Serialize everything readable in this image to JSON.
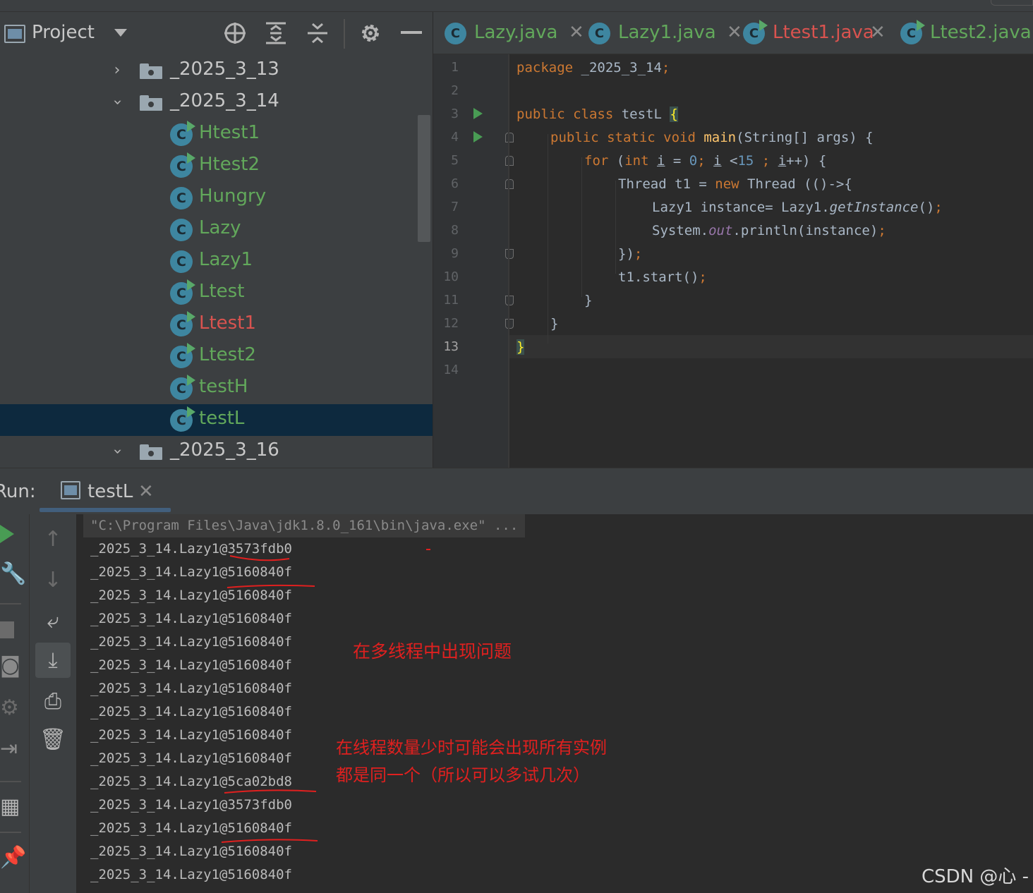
{
  "project_panel": {
    "title": "Project",
    "tree": [
      {
        "label": "_2025_3_13",
        "kind": "package",
        "expanded": false
      },
      {
        "label": "_2025_3_14",
        "kind": "package",
        "expanded": true
      },
      {
        "label": "Htest1",
        "kind": "class-runnable",
        "color": "green"
      },
      {
        "label": "Htest2",
        "kind": "class-runnable",
        "color": "green"
      },
      {
        "label": "Hungry",
        "kind": "class",
        "color": "green"
      },
      {
        "label": "Lazy",
        "kind": "class",
        "color": "green"
      },
      {
        "label": "Lazy1",
        "kind": "class",
        "color": "green"
      },
      {
        "label": "Ltest",
        "kind": "class-runnable",
        "color": "green"
      },
      {
        "label": "Ltest1",
        "kind": "class-runnable",
        "color": "red"
      },
      {
        "label": "Ltest2",
        "kind": "class-runnable",
        "color": "green"
      },
      {
        "label": "testH",
        "kind": "class-runnable",
        "color": "green"
      },
      {
        "label": "testL",
        "kind": "class-runnable",
        "color": "green",
        "selected": true
      },
      {
        "label": "_2025_3_16",
        "kind": "package",
        "expanded": true
      }
    ]
  },
  "editor": {
    "tabs": [
      {
        "label": "Lazy.java",
        "color": "green",
        "runnable": false
      },
      {
        "label": "Lazy1.java",
        "color": "green",
        "runnable": false
      },
      {
        "label": "Ltest1.java",
        "color": "red",
        "runnable": true
      },
      {
        "label": "Ltest2.java",
        "color": "green",
        "runnable": true
      }
    ],
    "line_numbers": [
      "1",
      "2",
      "3",
      "4",
      "5",
      "6",
      "7",
      "8",
      "9",
      "10",
      "11",
      "12",
      "13",
      "14"
    ],
    "current_line": "13",
    "code": {
      "l1_kw": "package",
      "l1_rest": " _2025_3_14",
      "l1_semi": ";",
      "l3_kw": "public class",
      "l3_name": " testL ",
      "l3_brace": "{",
      "l4_kw": "public static void",
      "l4_sp": " ",
      "l4_fn": "main",
      "l4_rest": "(String[] args) {",
      "l5_for": "for",
      "l5_p": " (",
      "l5_int": "int",
      "l5_sp": " ",
      "l5_i1": "i",
      "l5_eq": " = ",
      "l5_zero": "0",
      "l5_semi1": "; ",
      "l5_i2": "i",
      "l5_lt": " <",
      "l5_15": "15",
      "l5_semi2": " ; ",
      "l5_i3": "i",
      "l5_end": "++) {",
      "l6_a": "Thread t1 = ",
      "l6_new": "new",
      "l6_b": " Thread (()->{",
      "l7_a": "Lazy1 instance= Lazy1.",
      "l7_get": "getInstance",
      "l7_b": "()",
      "l7_semi": ";",
      "l8_a": "System.",
      "l8_out": "out",
      "l8_b": ".println(instance)",
      "l8_semi": ";",
      "l9_a": "})",
      "l9_semi": ";",
      "l10_a": "t1.start()",
      "l10_semi": ";",
      "l11": "}",
      "l12": "}",
      "l13": "}"
    }
  },
  "run_panel": {
    "label": "Run:",
    "tab_label": "testL",
    "command": "\"C:\\Program Files\\Java\\jdk1.8.0_161\\bin\\java.exe\" ...",
    "output": [
      "_2025_3_14.Lazy1@3573fdb0",
      "_2025_3_14.Lazy1@5160840f",
      "_2025_3_14.Lazy1@5160840f",
      "_2025_3_14.Lazy1@5160840f",
      "_2025_3_14.Lazy1@5160840f",
      "_2025_3_14.Lazy1@5160840f",
      "_2025_3_14.Lazy1@5160840f",
      "_2025_3_14.Lazy1@5160840f",
      "_2025_3_14.Lazy1@5160840f",
      "_2025_3_14.Lazy1@5160840f",
      "_2025_3_14.Lazy1@5ca02bd8",
      "_2025_3_14.Lazy1@3573fdb0",
      "_2025_3_14.Lazy1@5160840f",
      "_2025_3_14.Lazy1@5160840f",
      "_2025_3_14.Lazy1@5160840f"
    ]
  },
  "annotations": {
    "note1": "在多线程中出现问题",
    "note2_line1": "在线程数量少时可能会出现所有实例",
    "note2_line2": "都是同一个（所以可以多试几次）",
    "color": "#e0201f"
  },
  "watermark": "CSDN @心 -",
  "colors": {
    "class_green": "#62a85b",
    "class_red": "#d9534f",
    "selection": "#0d293e",
    "keyword": "#cc7832",
    "method": "#ffc66d",
    "number": "#6897bb",
    "field": "#9876aa"
  }
}
